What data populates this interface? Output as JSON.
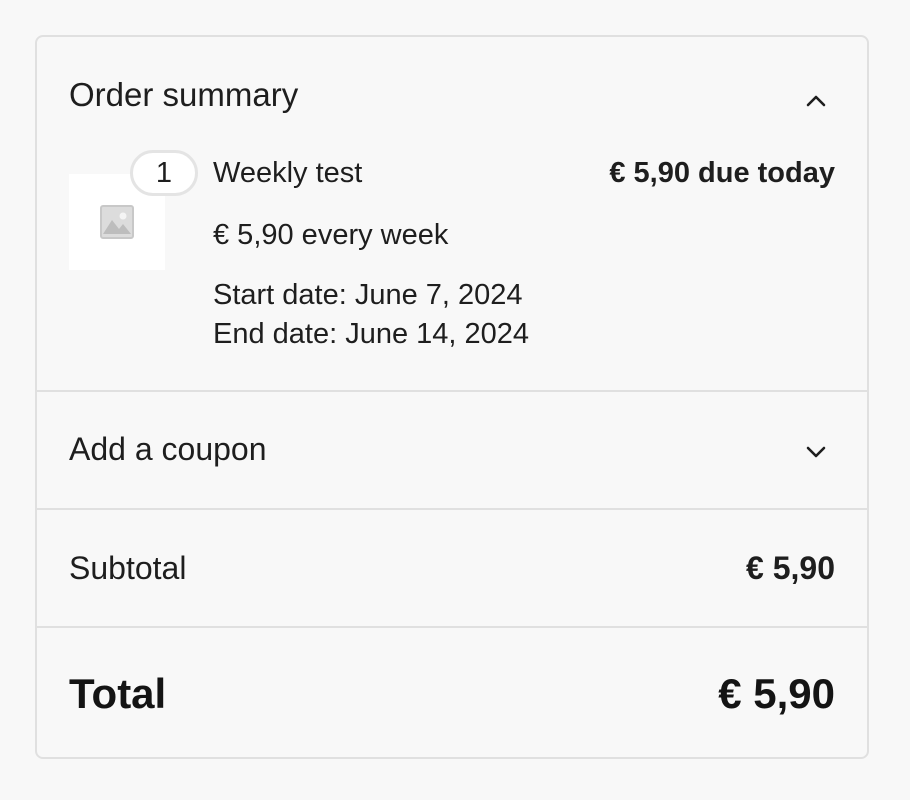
{
  "order_summary": {
    "title": "Order summary",
    "toggle_icon": "chevron-up-icon"
  },
  "item": {
    "quantity": "1",
    "name": "Weekly test",
    "price_due": "€ 5,90 due today",
    "recurring": "€ 5,90 every week",
    "start_date": "Start date: June 7, 2024",
    "end_date": "End date: June 14, 2024",
    "thumbnail_icon": "image-placeholder-icon"
  },
  "coupon": {
    "label": "Add a coupon",
    "toggle_icon": "chevron-down-icon"
  },
  "subtotal": {
    "label": "Subtotal",
    "value": "€ 5,90"
  },
  "total": {
    "label": "Total",
    "value": "€ 5,90"
  }
}
